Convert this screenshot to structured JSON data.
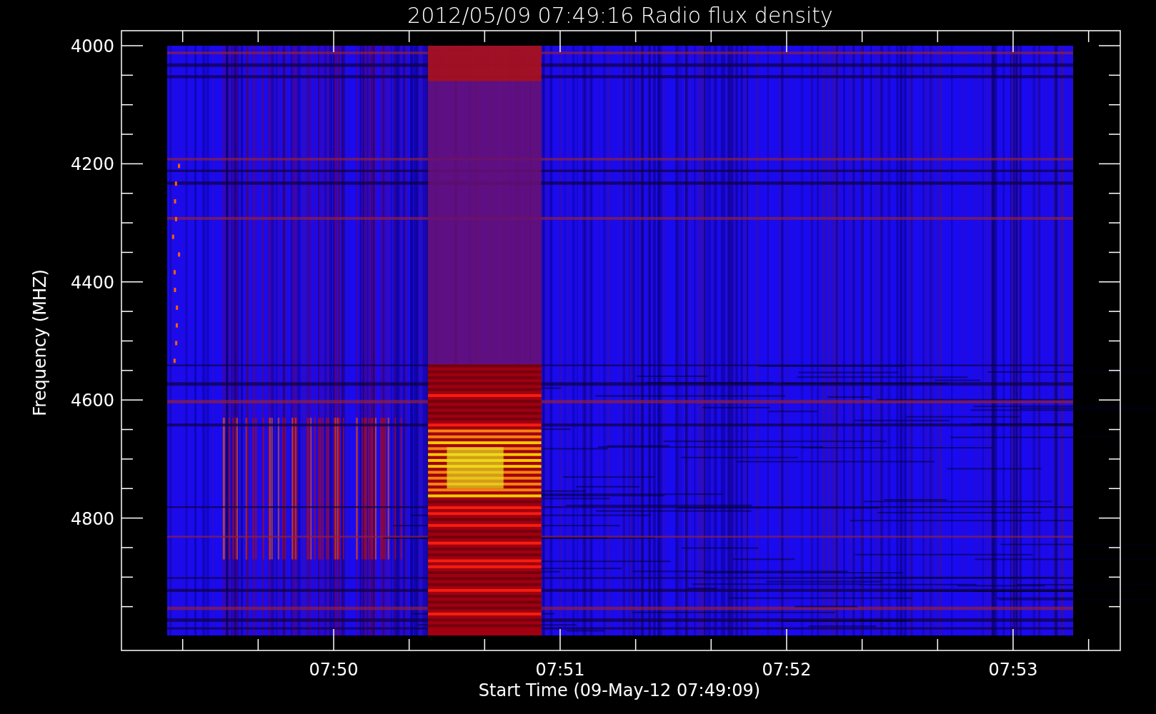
{
  "title": "2012/05/09 07:49:16 Radio flux density",
  "y_axis": {
    "label": "Frequency (MHZ)",
    "tick_labels": [
      "4000",
      "4200",
      "4400",
      "4600",
      "4800"
    ]
  },
  "x_axis": {
    "label": "Start Time (09-May-12 07:49:09)",
    "tick_labels": [
      "07:50",
      "07:51",
      "07:52",
      "07:53"
    ]
  }
}
